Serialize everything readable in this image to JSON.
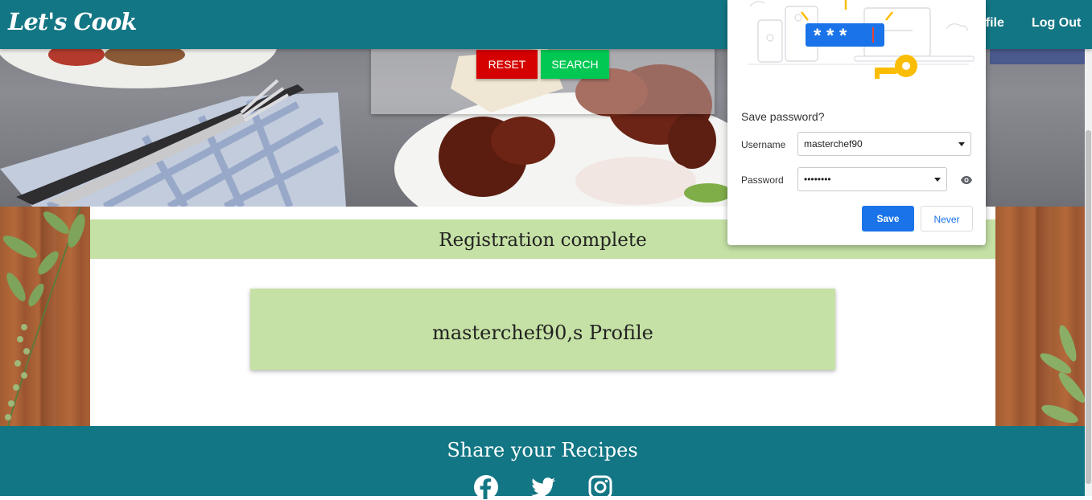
{
  "navbar": {
    "brand": "Let's Cook",
    "links": [
      {
        "label": "ofile"
      },
      {
        "label": "Log Out"
      }
    ]
  },
  "search_panel": {
    "reset_label": "RESET",
    "search_label": "SEARCH"
  },
  "main": {
    "banner_text": "Registration complete",
    "profile_card_text": "masterchef90,s Profile"
  },
  "footer": {
    "title": "Share your Recipes",
    "social_icons": [
      "facebook-icon",
      "twitter-icon",
      "instagram-icon"
    ]
  },
  "password_popup": {
    "masked_preview": "* * *",
    "title": "Save password?",
    "username_label": "Username",
    "username_value": "masterchef90",
    "password_label": "Password",
    "password_value": "••••••••",
    "save_label": "Save",
    "never_label": "Never"
  },
  "colors": {
    "nav_teal": "#137684",
    "banner_green": "#c5e1a5",
    "reset_red": "#d50000",
    "search_green": "#00c853",
    "save_blue": "#1a73e8"
  }
}
